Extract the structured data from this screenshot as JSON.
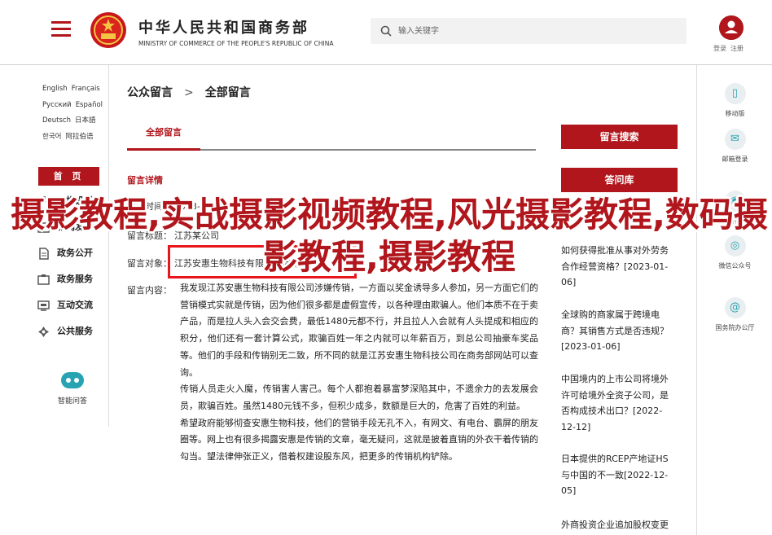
{
  "header": {
    "ministry_cn": "中华人民共和国商务部",
    "ministry_en": "MINISTRY OF COMMERCE OF THE PEOPLE'S REPUBLIC OF CHINA",
    "search_placeholder": "输入关键字",
    "login": "登录",
    "register": "注册"
  },
  "left_nav": {
    "languages": [
      [
        "English",
        "Français"
      ],
      [
        "Русский",
        "Español"
      ],
      [
        "Deutsch",
        "日本語"
      ],
      [
        "한국어",
        "阿拉伯语"
      ]
    ],
    "home": "首 页",
    "items": [
      {
        "label": "机构设置",
        "icon": "org-icon"
      },
      {
        "label": "新闻发布",
        "icon": "news-icon"
      },
      {
        "label": "政务公开",
        "icon": "doc-icon"
      },
      {
        "label": "政务服务",
        "icon": "service-icon"
      },
      {
        "label": "互动交流",
        "icon": "chat-icon"
      },
      {
        "label": "公共服务",
        "icon": "public-icon"
      }
    ],
    "smart": "智能问答"
  },
  "breadcrumb": {
    "root": "公众留言",
    "sep": ">",
    "current": "全部留言"
  },
  "tab": {
    "label": "全部留言"
  },
  "detail": {
    "section_label": "留言详情",
    "date_label": "留言时间：",
    "date_value": "2023-01-17",
    "title_label": "留言标题：",
    "title_value": "江苏某公司",
    "company_label": "留言对象：",
    "company_value": "江苏安惠生物科技有限公司涉嫌传销",
    "content_label": "留言内容：",
    "paragraphs": [
      "我发现江苏安惠生物科技有限公司涉嫌传销，一方面以奖金诱导多人参加，另一方面它们的营销模式实就是传销，因为他们很多都是虚假宣传，以各种理由欺骗人。他们本质不在于卖产品，而是拉人头入会交会费，最低1480元都不行，并且拉人入会就有人头提成和相应的积分，他们还有一套计算公式，欺骗百姓一年之内就可以年薪百万，到总公司抽豪车奖品等。他们的手段和传销别无二致，所不同的就是江苏安惠生物科技公司在商务部网站可以查询。",
      "传销人员走火入魔，传销害人害己。每个人都抱着暴富梦深陷其中，不遗余力的去发展会员，欺骗百姓。虽然1480元钱不多，但积少成多，数额是巨大的，危害了百姓的利益。",
      "希望政府能够彻查安惠生物科技，他们的营销手段无孔不入，有网文、有电台、霸屏的朋友圈等。网上也有很多揭露安惠是传销的文章，毫无疑问，这就是披着直销的外衣干着传销的勾当。望法律伸张正义，借着权建设股东风，把更多的传销机构铲除。"
    ]
  },
  "right_panel": {
    "search_btn": "留言搜索",
    "qa_btn": "答问库",
    "news": [
      "如何获得批准从事对外劳务合作经营资格？[2023-01-06]",
      "全球购的商家属于跨境电商？其销售方式是否违规？[2023-01-06]",
      "中国境内的上市公司将境外许可给境外全资子公司，是否构成技术出口？[2022-12-12]",
      "日本提供的RCEP产地证HS与中国的不一致[2022-12-05]",
      "外商投资企业追加股权变更"
    ]
  },
  "right_side": [
    {
      "label": "移动版",
      "icon": "mobile-icon"
    },
    {
      "label": "邮箱登录",
      "icon": "mail-icon"
    },
    {
      "label": "官方微博",
      "icon": "weibo-icon"
    },
    {
      "label": "微信公众号",
      "icon": "wechat-icon"
    },
    {
      "label": "国务院办公厅",
      "icon": "at-icon"
    }
  ],
  "overlay_text": "摄影教程,实战摄影视频教程,风光摄影教程,数码摄影教程,摄影教程",
  "colors": {
    "brand_red": "#b0161c",
    "overlay_red": "#b0161c",
    "box_red": "#e8161c",
    "teal": "#28a3b1"
  }
}
